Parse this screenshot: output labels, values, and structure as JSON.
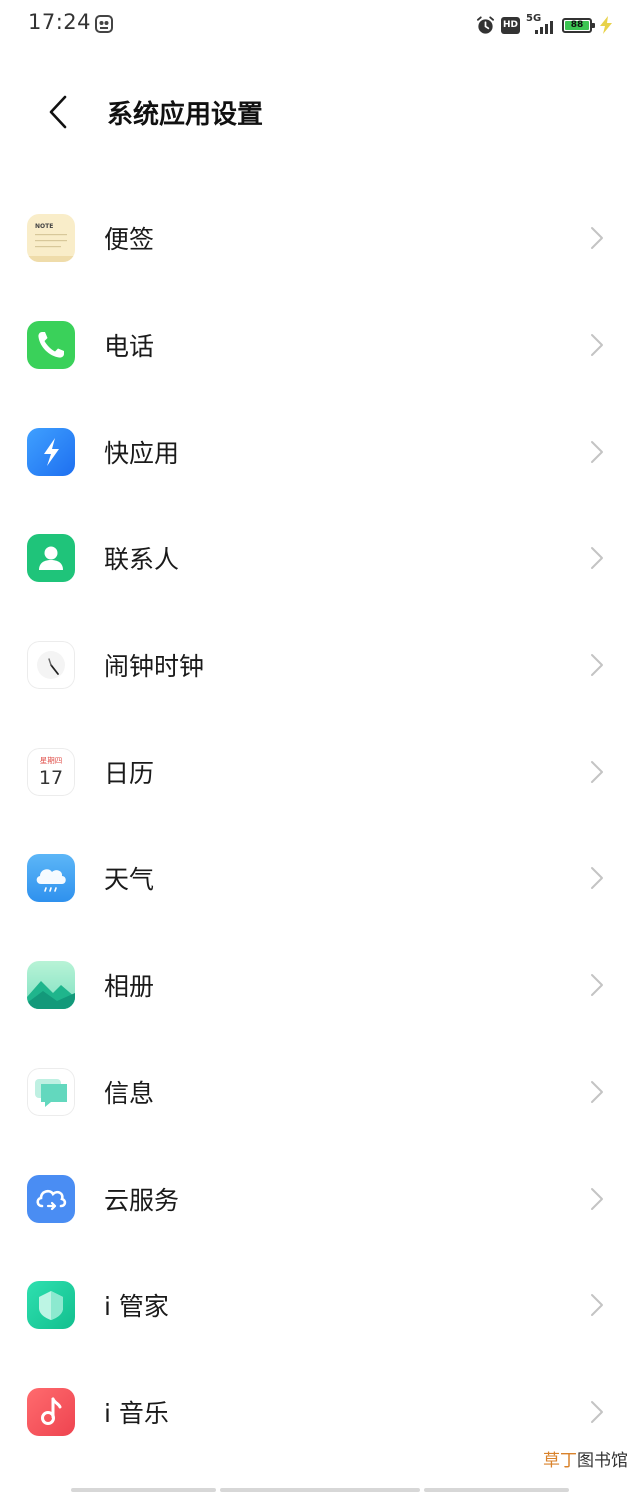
{
  "status_bar": {
    "time": "17:24",
    "network": "5G",
    "hd": "HD",
    "battery": "88"
  },
  "header": {
    "title": "系统应用设置"
  },
  "apps": [
    {
      "label": "便签",
      "icon": "notes-icon"
    },
    {
      "label": "电话",
      "icon": "phone-icon"
    },
    {
      "label": "快应用",
      "icon": "quick-app-icon"
    },
    {
      "label": "联系人",
      "icon": "contacts-icon"
    },
    {
      "label": "闹钟时钟",
      "icon": "clock-icon"
    },
    {
      "label": "日历",
      "icon": "calendar-icon"
    },
    {
      "label": "天气",
      "icon": "weather-icon"
    },
    {
      "label": "相册",
      "icon": "gallery-icon"
    },
    {
      "label": "信息",
      "icon": "messages-icon"
    },
    {
      "label": "云服务",
      "icon": "cloud-service-icon"
    },
    {
      "label": "i 管家",
      "icon": "i-manager-icon"
    },
    {
      "label": "i 音乐",
      "icon": "i-music-icon"
    }
  ],
  "icon_text": {
    "note": "NOTE",
    "calendar_weekday": "星期四",
    "calendar_day": "17"
  },
  "watermark": {
    "part1": "草丁",
    "part2": "图书馆"
  },
  "colors": {
    "phone": "#3ad15a",
    "quick_app": "#2f86f6",
    "contacts": "#1fc47a",
    "weather": "#45a8f4",
    "cloud": "#4a8df3",
    "i_manager": "#1fd0a0",
    "i_music": "#f2555a",
    "chevron": "#c4c4c4"
  }
}
